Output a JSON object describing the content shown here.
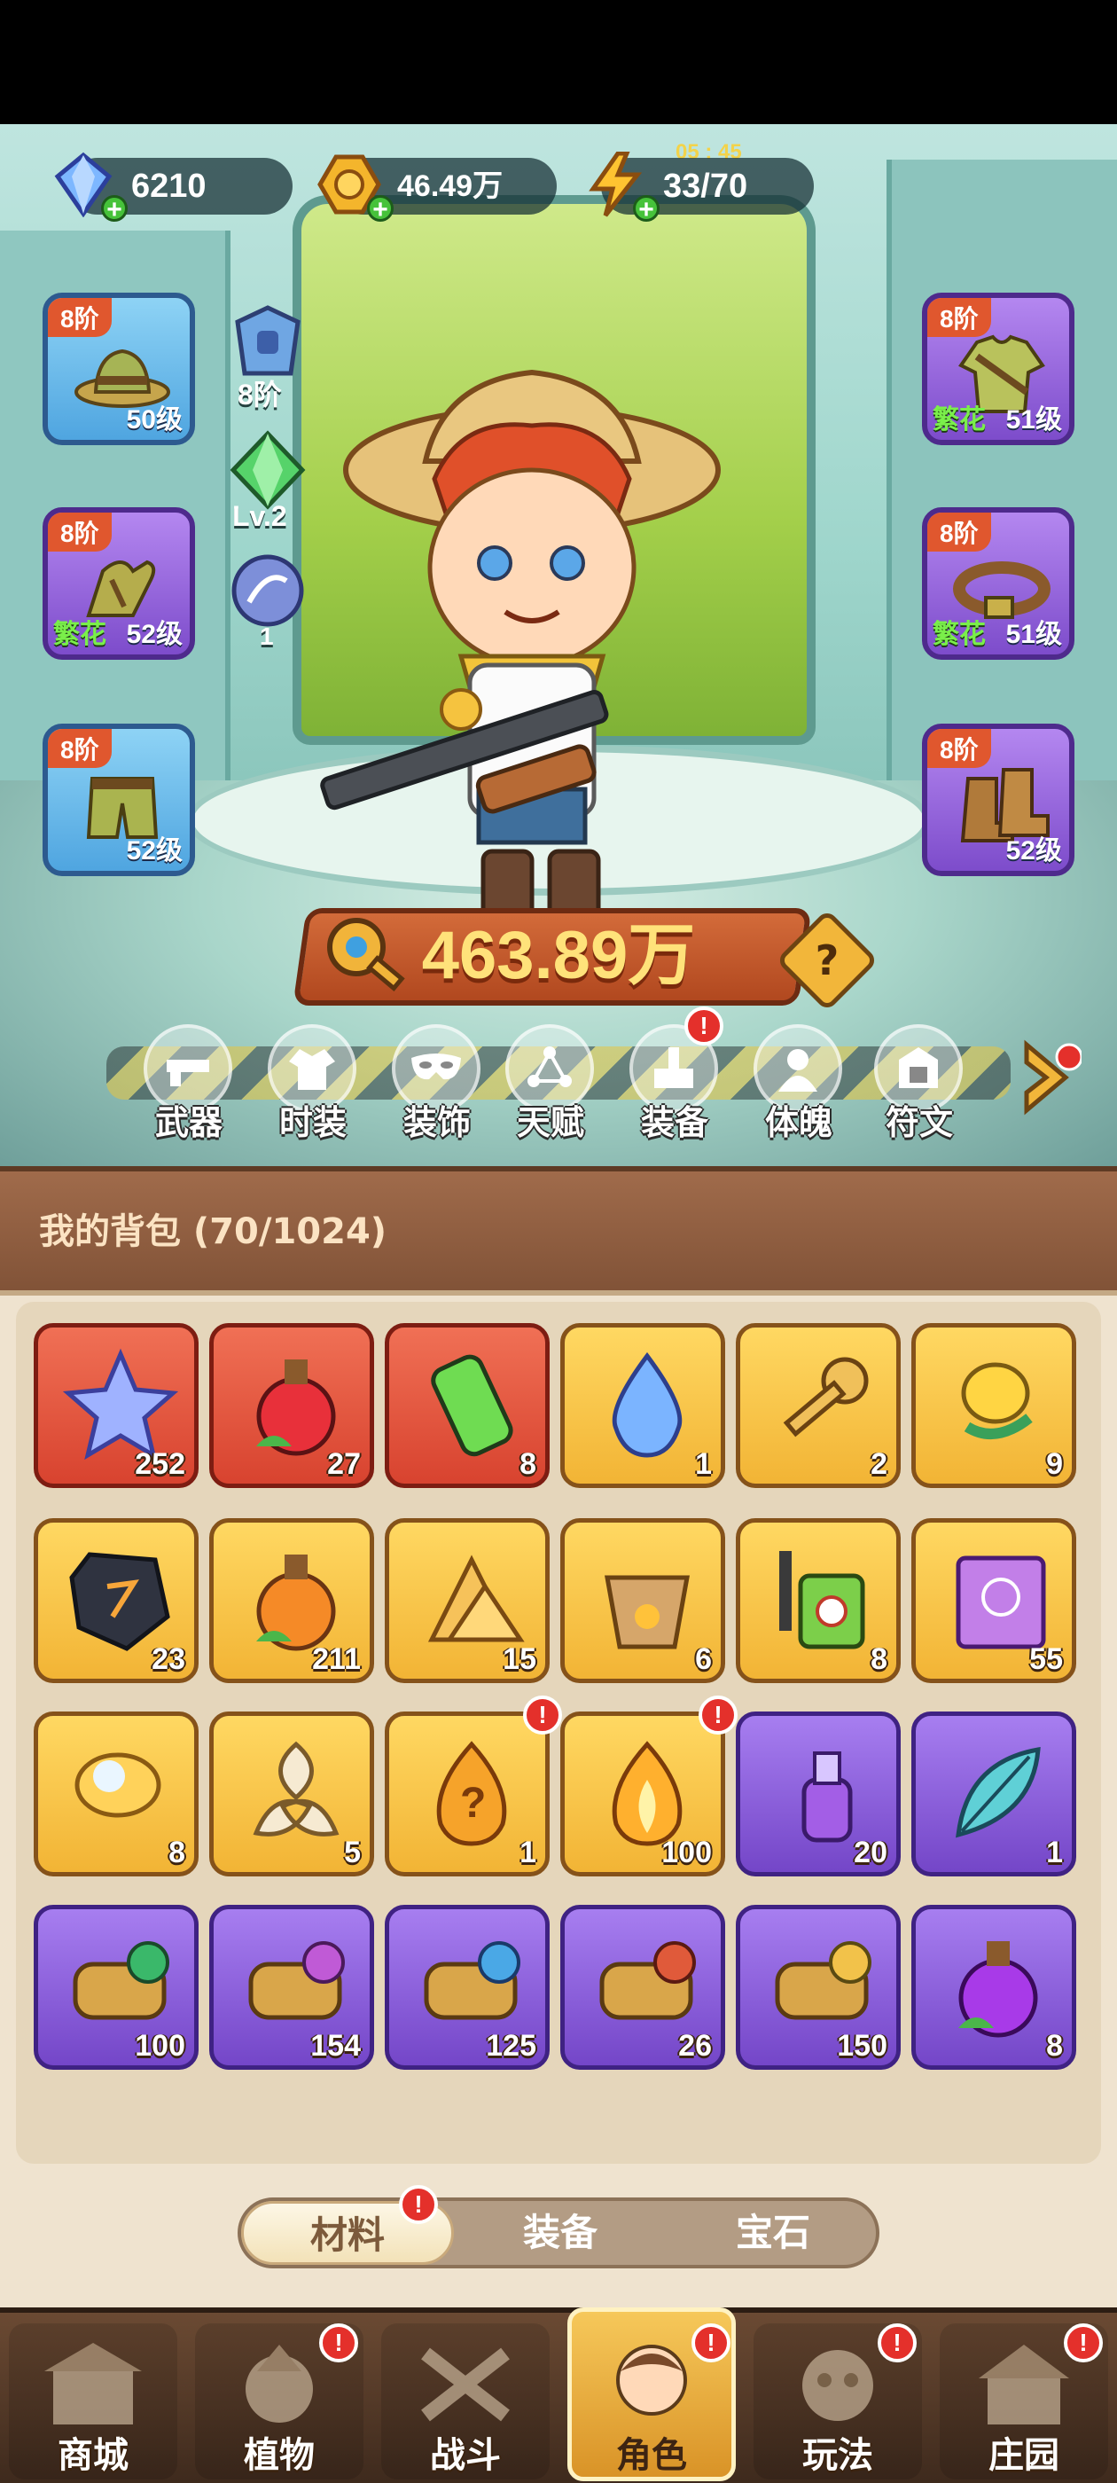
{
  "resources": {
    "gems": "6210",
    "coins": "46.49万",
    "energy": "33/70",
    "energy_timer": "05 : 45"
  },
  "equipment_slots": {
    "left": [
      {
        "tier": "8阶",
        "level": "50级",
        "tag": "",
        "item": "hat"
      },
      {
        "tier": "8阶",
        "level": "52级",
        "tag": "繁花",
        "item": "gloves"
      },
      {
        "tier": "8阶",
        "level": "52级",
        "tag": "",
        "item": "pants"
      }
    ],
    "right": [
      {
        "tier": "8阶",
        "level": "51级",
        "tag": "繁花",
        "item": "shirt"
      },
      {
        "tier": "8阶",
        "level": "51级",
        "tag": "繁花",
        "item": "belt"
      },
      {
        "tier": "8阶",
        "level": "52级",
        "tag": "",
        "item": "boots"
      }
    ]
  },
  "mini_stats": {
    "armor_tier": "8阶",
    "gem_level": "Lv.2",
    "talent_count": "1"
  },
  "combat_power": "463.89万",
  "role_nav": [
    {
      "label": "武器",
      "icon": "weapon-icon",
      "badge": false
    },
    {
      "label": "时装",
      "icon": "costume-icon",
      "badge": false
    },
    {
      "label": "装饰",
      "icon": "mask-icon",
      "badge": false
    },
    {
      "label": "天赋",
      "icon": "talent-icon",
      "badge": false
    },
    {
      "label": "装备",
      "icon": "equipment-icon",
      "badge": true
    },
    {
      "label": "体魄",
      "icon": "physique-icon",
      "badge": false
    },
    {
      "label": "符文",
      "icon": "rune-icon",
      "badge": false
    }
  ],
  "bag": {
    "title": "我的背包 (70/1024)",
    "items": [
      {
        "count": "252",
        "rarity": "red",
        "icon": "star-crystal-icon",
        "badge": false
      },
      {
        "count": "27",
        "rarity": "red",
        "icon": "red-potion-icon",
        "badge": false
      },
      {
        "count": "8",
        "rarity": "red",
        "icon": "green-canister-icon",
        "badge": false
      },
      {
        "count": "1",
        "rarity": "gold",
        "icon": "water-drop-icon",
        "badge": false
      },
      {
        "count": "2",
        "rarity": "gold",
        "icon": "key-icon",
        "badge": false
      },
      {
        "count": "9",
        "rarity": "gold",
        "icon": "golden-bud-icon",
        "badge": false
      },
      {
        "count": "23",
        "rarity": "gold",
        "icon": "rune-stone-icon",
        "badge": false
      },
      {
        "count": "211",
        "rarity": "gold",
        "icon": "orange-potion-icon",
        "badge": false
      },
      {
        "count": "15",
        "rarity": "gold",
        "icon": "gold-pile-icon",
        "badge": false
      },
      {
        "count": "6",
        "rarity": "gold",
        "icon": "flower-pot-icon",
        "badge": false
      },
      {
        "count": "8",
        "rarity": "gold",
        "icon": "sprayer-icon",
        "badge": false
      },
      {
        "count": "55",
        "rarity": "gold",
        "icon": "spell-book-icon",
        "badge": false
      },
      {
        "count": "8",
        "rarity": "gold",
        "icon": "lily-icon",
        "badge": false
      },
      {
        "count": "5",
        "rarity": "gold",
        "icon": "celtic-knot-icon",
        "badge": false
      },
      {
        "count": "1",
        "rarity": "gold",
        "icon": "mystery-flame-icon",
        "badge": true
      },
      {
        "count": "100",
        "rarity": "gold",
        "icon": "flame-icon",
        "badge": true
      },
      {
        "count": "20",
        "rarity": "purple",
        "icon": "purple-bottle-icon",
        "badge": false
      },
      {
        "count": "1",
        "rarity": "purple",
        "icon": "feather-leaf-icon",
        "badge": false
      },
      {
        "count": "100",
        "rarity": "purple",
        "icon": "scroll-green-icon",
        "badge": false
      },
      {
        "count": "154",
        "rarity": "purple",
        "icon": "scroll-pink-icon",
        "badge": false
      },
      {
        "count": "125",
        "rarity": "purple",
        "icon": "scroll-blue-icon",
        "badge": false
      },
      {
        "count": "26",
        "rarity": "purple",
        "icon": "scroll-red-icon",
        "badge": false
      },
      {
        "count": "150",
        "rarity": "purple",
        "icon": "scroll-yellow-icon",
        "badge": false
      },
      {
        "count": "8",
        "rarity": "purple",
        "icon": "purple-potion-icon",
        "badge": false
      }
    ]
  },
  "bag_tabs": [
    {
      "label": "材料",
      "active": true,
      "badge": true
    },
    {
      "label": "装备",
      "active": false,
      "badge": false
    },
    {
      "label": "宝石",
      "active": false,
      "badge": false
    }
  ],
  "bottom_nav": [
    {
      "label": "商城",
      "icon": "shop-icon",
      "active": false,
      "badge": false
    },
    {
      "label": "植物",
      "icon": "plant-icon",
      "active": false,
      "badge": true
    },
    {
      "label": "战斗",
      "icon": "battle-icon",
      "active": false,
      "badge": false
    },
    {
      "label": "角色",
      "icon": "character-icon",
      "active": true,
      "badge": true
    },
    {
      "label": "玩法",
      "icon": "gameplay-icon",
      "active": false,
      "badge": true
    },
    {
      "label": "庄园",
      "icon": "manor-icon",
      "active": false,
      "badge": true
    }
  ],
  "colors": {
    "accent_orange": "#e0572e",
    "rarity_red": "#d8432f",
    "rarity_gold": "#f2b435",
    "rarity_purple": "#7446c8",
    "badge_red": "#e4302b"
  }
}
